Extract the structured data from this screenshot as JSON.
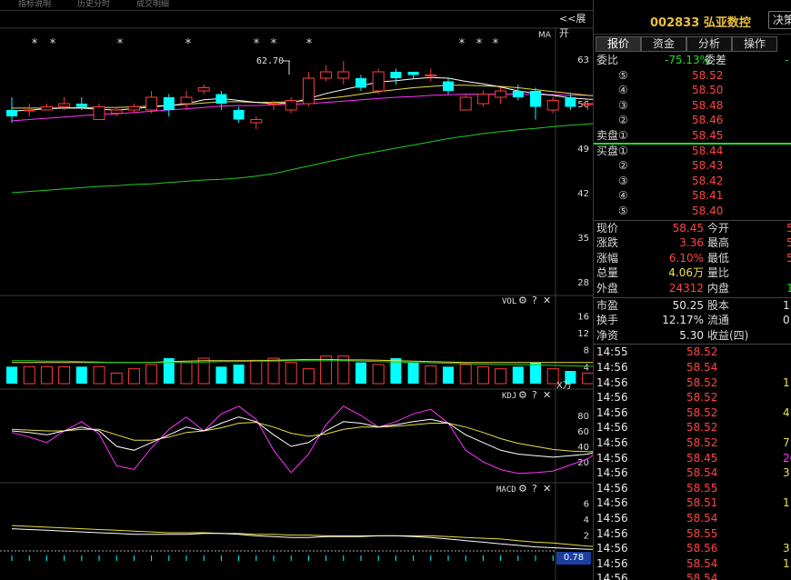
{
  "top_strip": [
    "指标说明",
    "历史分时",
    "成交明细"
  ],
  "expand_label": "<<展开",
  "stock": {
    "code": "002833",
    "name": "弘亚数控",
    "button": "决策"
  },
  "tabs": [
    "报价",
    "资金",
    "分析",
    "操作"
  ],
  "weibi": {
    "label": "委比",
    "value": "-75.13%",
    "weicha_label": "委差",
    "weicha_value": "-"
  },
  "asks": [
    {
      "idx": "⑤",
      "price": "58.52"
    },
    {
      "idx": "④",
      "price": "58.50"
    },
    {
      "idx": "③",
      "price": "58.48"
    },
    {
      "idx": "②",
      "price": "58.46"
    },
    {
      "idx": "①",
      "price": "58.45",
      "label": "卖盘"
    }
  ],
  "bids": [
    {
      "idx": "①",
      "price": "58.44",
      "label": "买盘"
    },
    {
      "idx": "②",
      "price": "58.43"
    },
    {
      "idx": "③",
      "price": "58.42"
    },
    {
      "idx": "④",
      "price": "58.41"
    },
    {
      "idx": "⑤",
      "price": "58.40"
    }
  ],
  "stats": [
    {
      "l1": "现价",
      "v1": "58.45",
      "c1": "red",
      "l2": "今开",
      "v2": "5",
      "c2": "red"
    },
    {
      "l1": "涨跌",
      "v1": "3.36",
      "c1": "red",
      "l2": "最高",
      "v2": "5",
      "c2": "red"
    },
    {
      "l1": "涨幅",
      "v1": "6.10%",
      "c1": "red",
      "l2": "最低",
      "v2": "5",
      "c2": "red"
    },
    {
      "l1": "总量",
      "v1": "4.06万",
      "c1": "yellow",
      "l2": "量比",
      "v2": "",
      "c2": "white"
    },
    {
      "l1": "外盘",
      "v1": "24312",
      "c1": "red",
      "l2": "内盘",
      "v2": "1",
      "c2": "green"
    }
  ],
  "fundamentals": [
    {
      "l1": "市盈",
      "v1": "50.25",
      "l2": "股本",
      "v2": "1."
    },
    {
      "l1": "换手",
      "v1": "12.17%",
      "l2": "流通",
      "v2": "0."
    },
    {
      "l1": "净资",
      "v1": "5.30",
      "l2": "收益(四)",
      "v2": ""
    }
  ],
  "ticks": [
    {
      "time": "14:55",
      "price": "58.52",
      "vol": "",
      "c": "red"
    },
    {
      "time": "14:56",
      "price": "58.54",
      "vol": "",
      "c": "red"
    },
    {
      "time": "14:56",
      "price": "58.52",
      "vol": "1",
      "c": "yellow"
    },
    {
      "time": "14:56",
      "price": "58.52",
      "vol": "",
      "c": "red"
    },
    {
      "time": "14:56",
      "price": "58.52",
      "vol": "4",
      "c": "yellow"
    },
    {
      "time": "14:56",
      "price": "58.52",
      "vol": "",
      "c": "red"
    },
    {
      "time": "14:56",
      "price": "58.52",
      "vol": "7",
      "c": "yellow"
    },
    {
      "time": "14:56",
      "price": "58.45",
      "vol": "20",
      "c": "magenta"
    },
    {
      "time": "14:56",
      "price": "58.54",
      "vol": "3",
      "c": "yellow"
    },
    {
      "time": "14:56",
      "price": "58.55",
      "vol": "",
      "c": "red"
    },
    {
      "time": "14:56",
      "price": "58.51",
      "vol": "1",
      "c": "yellow"
    },
    {
      "time": "14:56",
      "price": "58.54",
      "vol": "",
      "c": "red"
    },
    {
      "time": "14:56",
      "price": "58.55",
      "vol": "",
      "c": "red"
    },
    {
      "time": "14:56",
      "price": "58.56",
      "vol": "3",
      "c": "yellow"
    },
    {
      "time": "14:56",
      "price": "58.54",
      "vol": "1",
      "c": "yellow"
    },
    {
      "time": "14:56",
      "price": "58.54",
      "vol": "",
      "c": "red"
    }
  ],
  "chart_data": {
    "type": "candlestick",
    "price_axis": [
      "63",
      "56",
      "49",
      "42",
      "35",
      "28"
    ],
    "price_ylim": [
      28,
      63
    ],
    "ma_label": "MA",
    "high_annotation": "62.70",
    "candles": [
      [
        55,
        54,
        57,
        53
      ],
      [
        55,
        55,
        56,
        54
      ],
      [
        55,
        55.5,
        56,
        55
      ],
      [
        55.5,
        56,
        57,
        55
      ],
      [
        56,
        55.5,
        57,
        55
      ],
      [
        53.5,
        55.5,
        56,
        53.5
      ],
      [
        54.5,
        55,
        55.5,
        54
      ],
      [
        55,
        55.5,
        56,
        54.5
      ],
      [
        55,
        57,
        58,
        54.5
      ],
      [
        57,
        55,
        57.5,
        54
      ],
      [
        56,
        57,
        58,
        55
      ],
      [
        58,
        58.5,
        59,
        57.5
      ],
      [
        57.5,
        56,
        58,
        55
      ],
      [
        55,
        53.5,
        55.5,
        53
      ],
      [
        53,
        53.5,
        54,
        52
      ],
      [
        56,
        56,
        56.5,
        55
      ],
      [
        55,
        56.5,
        57,
        54.5
      ],
      [
        56,
        60,
        61,
        55.5
      ],
      [
        60,
        61,
        62,
        59.5
      ],
      [
        60,
        61,
        62.7,
        59
      ],
      [
        60,
        58.5,
        60.5,
        58
      ],
      [
        58,
        61,
        61.5,
        57.5
      ],
      [
        61,
        60,
        61.5,
        59
      ],
      [
        61,
        60.5,
        61,
        60
      ],
      [
        60.5,
        60.5,
        61.5,
        59.5
      ],
      [
        59.5,
        58,
        60,
        57.5
      ],
      [
        55,
        57,
        57.5,
        55
      ],
      [
        56,
        57.5,
        58,
        55.5
      ],
      [
        57,
        58,
        58.5,
        56
      ],
      [
        58,
        57,
        59,
        56.5
      ],
      [
        58,
        55.5,
        58.5,
        53.5
      ],
      [
        55,
        56.5,
        57,
        54.5
      ],
      [
        57,
        55.5,
        57.5,
        55
      ],
      [
        56,
        56,
        56.5,
        55
      ],
      [
        55.5,
        56.5,
        57,
        55
      ],
      [
        56,
        57.5,
        58.5,
        55.5
      ],
      [
        57.5,
        60,
        61,
        57
      ]
    ],
    "ma_white": [
      54.8,
      55,
      55.2,
      55.3,
      55.3,
      55.1,
      55,
      55.2,
      55.5,
      55.7,
      56,
      56.6,
      56.8,
      56.5,
      56.2,
      56,
      56.1,
      56.8,
      57.6,
      58.2,
      58.8,
      59.4,
      59.6,
      59.9,
      60.1,
      60,
      59.5,
      59.1,
      58.6,
      58,
      57.6,
      57.3,
      56.9,
      56.7,
      56.6,
      56.8,
      57.4
    ],
    "ma_yellow": [
      55.3,
      55.3,
      55.3,
      55.3,
      55.4,
      55.4,
      55.4,
      55.5,
      55.6,
      55.7,
      55.9,
      56.1,
      56.3,
      56.3,
      56.2,
      56.2,
      56.3,
      56.5,
      56.8,
      57.1,
      57.5,
      57.9,
      58.2,
      58.5,
      58.7,
      58.9,
      58.9,
      58.8,
      58.7,
      58.5,
      58.2,
      57.9,
      57.6,
      57.3,
      57.1,
      57,
      57
    ],
    "ma_magenta": [
      53.3,
      53.5,
      53.7,
      53.9,
      54.1,
      54.3,
      54.4,
      54.6,
      54.8,
      55,
      55.2,
      55.4,
      55.6,
      55.7,
      55.7,
      55.8,
      55.9,
      56,
      56.2,
      56.4,
      56.6,
      56.8,
      57,
      57.1,
      57.3,
      57.4,
      57.5,
      57.5,
      57.5,
      57.5,
      57.4,
      57.4,
      57.3,
      57.3,
      57.2,
      57.2,
      57.2
    ],
    "ma_green": [
      42,
      42.2,
      42.4,
      42.6,
      42.8,
      43,
      43.1,
      43.3,
      43.4,
      43.6,
      43.8,
      44,
      44.1,
      44.3,
      44.6,
      45,
      45.6,
      46.2,
      46.8,
      47.4,
      48,
      48.5,
      49,
      49.5,
      50,
      50.5,
      50.9,
      51.3,
      51.6,
      51.9,
      52.1,
      52.4,
      52.6,
      52.8,
      53,
      53.2,
      53.4
    ],
    "vol": {
      "title": "VOL",
      "unit": "X万",
      "axis": [
        "16",
        "12",
        "8",
        "4"
      ],
      "ylim": [
        0,
        18
      ],
      "values": [
        4,
        4,
        4,
        4,
        4,
        4,
        2.5,
        3.5,
        4.5,
        6,
        5,
        6,
        4,
        4.5,
        5.5,
        6,
        5,
        3.5,
        6.5,
        6.5,
        5,
        4.5,
        6,
        5,
        4.2,
        4,
        4.5,
        4,
        3.5,
        4,
        5,
        3.5,
        3,
        2.5,
        2,
        3.2,
        3.6
      ],
      "ma1": [
        5,
        5,
        5,
        5,
        5,
        5,
        5,
        5,
        5,
        5.2,
        5.3,
        5.4,
        5.4,
        5.4,
        5.4,
        5.5,
        5.6,
        5.7,
        5.7,
        5.6,
        5.6,
        5.5,
        5.4,
        5.3,
        5.2,
        5.1,
        5,
        5,
        5,
        5,
        5,
        5,
        5,
        5,
        5,
        5,
        5
      ],
      "ma2": [
        5.4,
        5.4,
        5.3,
        5.3,
        5.2,
        5.1,
        5,
        5,
        5,
        5,
        5,
        5.1,
        5.2,
        5.2,
        5.3,
        5.3,
        5.4,
        5.4,
        5.4,
        5.4,
        5.3,
        5.2,
        5.1,
        5,
        4.9,
        4.8,
        4.7,
        4.6,
        4.5,
        4.5,
        4.4,
        4.3,
        4.2,
        4.1,
        4,
        4,
        4
      ]
    },
    "kdj": {
      "title": "KDJ",
      "axis": [
        "80",
        "60",
        "40",
        "20"
      ],
      "ylim": [
        0,
        100
      ],
      "k": [
        60,
        58,
        55,
        60,
        65,
        60,
        40,
        35,
        45,
        55,
        65,
        60,
        70,
        78,
        72,
        55,
        40,
        45,
        60,
        72,
        70,
        65,
        68,
        72,
        75,
        70,
        55,
        45,
        35,
        30,
        28,
        26,
        28,
        30,
        36,
        45,
        55
      ],
      "d": [
        62,
        61,
        60,
        60,
        62,
        62,
        55,
        48,
        48,
        52,
        58,
        60,
        64,
        70,
        71,
        65,
        57,
        53,
        56,
        62,
        65,
        65,
        66,
        68,
        70,
        70,
        65,
        58,
        50,
        44,
        40,
        36,
        34,
        33,
        34,
        38,
        44
      ],
      "j": [
        58,
        52,
        45,
        60,
        72,
        56,
        15,
        10,
        38,
        62,
        78,
        60,
        82,
        92,
        75,
        35,
        6,
        30,
        68,
        92,
        80,
        65,
        72,
        82,
        88,
        70,
        35,
        20,
        10,
        5,
        6,
        8,
        16,
        24,
        40,
        60,
        80
      ]
    },
    "macd": {
      "title": "MACD",
      "axis": [
        "6",
        "4",
        "2"
      ],
      "ylim": [
        0,
        7
      ],
      "dif": [
        2.8,
        2.7,
        2.6,
        2.5,
        2.4,
        2.3,
        2.2,
        2.1,
        2.1,
        2.1,
        2.1,
        2.2,
        2.2,
        2.1,
        1.9,
        1.8,
        1.7,
        1.7,
        1.8,
        1.8,
        1.8,
        1.9,
        1.9,
        1.8,
        1.7,
        1.5,
        1.3,
        1.1,
        0.9,
        0.7,
        0.5,
        0.4,
        0.3,
        0.2,
        0.2,
        0.4,
        0.6
      ],
      "dea": [
        3.2,
        3.1,
        3,
        2.9,
        2.8,
        2.7,
        2.6,
        2.5,
        2.4,
        2.3,
        2.3,
        2.3,
        2.2,
        2.2,
        2.1,
        2.1,
        2,
        2,
        1.9,
        1.9,
        1.9,
        1.9,
        1.9,
        1.9,
        1.9,
        1.8,
        1.7,
        1.6,
        1.5,
        1.3,
        1.1,
        1,
        0.8,
        0.6,
        0.5,
        0.5,
        0.5
      ],
      "value_box": "0.78"
    },
    "stars_x": [
      38,
      58,
      132,
      207,
      282,
      301,
      340,
      508,
      527,
      545
    ]
  }
}
